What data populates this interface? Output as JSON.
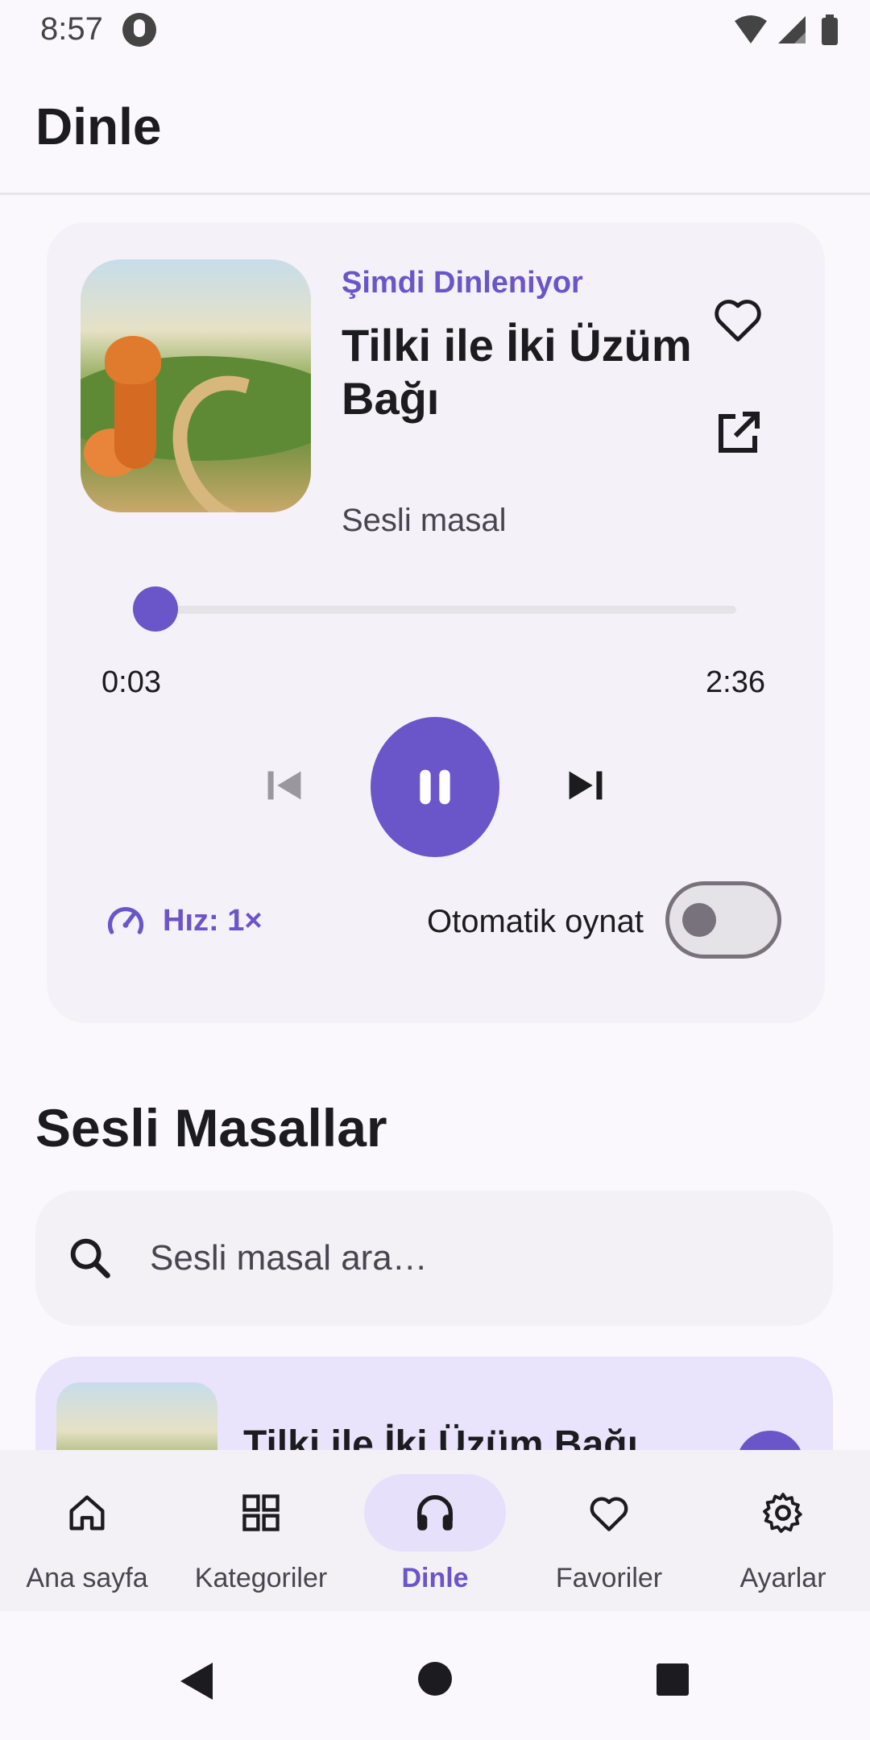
{
  "status_bar": {
    "time": "8:57"
  },
  "app_bar": {
    "title": "Dinle"
  },
  "player": {
    "now_playing_label": "Şimdi Dinleniyor",
    "title": "Tilki ile İki Üzüm Bağı",
    "subtitle": "Sesli masal",
    "elapsed": "0:03",
    "duration": "2:36",
    "progress_fraction": 0.02,
    "speed_label": "Hız: 1×",
    "autoplay_label": "Otomatik oynat",
    "autoplay_on": false,
    "is_playing": true
  },
  "section": {
    "title": "Sesli Masallar",
    "search_placeholder": "Sesli masal ara…"
  },
  "list": {
    "items": [
      {
        "title": "Tilki ile İki Üzüm Bağı"
      }
    ]
  },
  "bottom_nav": {
    "items": [
      {
        "label": "Ana sayfa",
        "icon": "home-icon"
      },
      {
        "label": "Kategoriler",
        "icon": "grid-icon"
      },
      {
        "label": "Dinle",
        "icon": "headphones-icon",
        "active": true
      },
      {
        "label": "Favoriler",
        "icon": "heart-icon"
      },
      {
        "label": "Ayarlar",
        "icon": "gear-icon"
      }
    ]
  },
  "colors": {
    "accent": "#6a55c9",
    "accent_container": "#e6e0fb",
    "surface": "#fbf8fd",
    "card": "#f4f1f8"
  }
}
